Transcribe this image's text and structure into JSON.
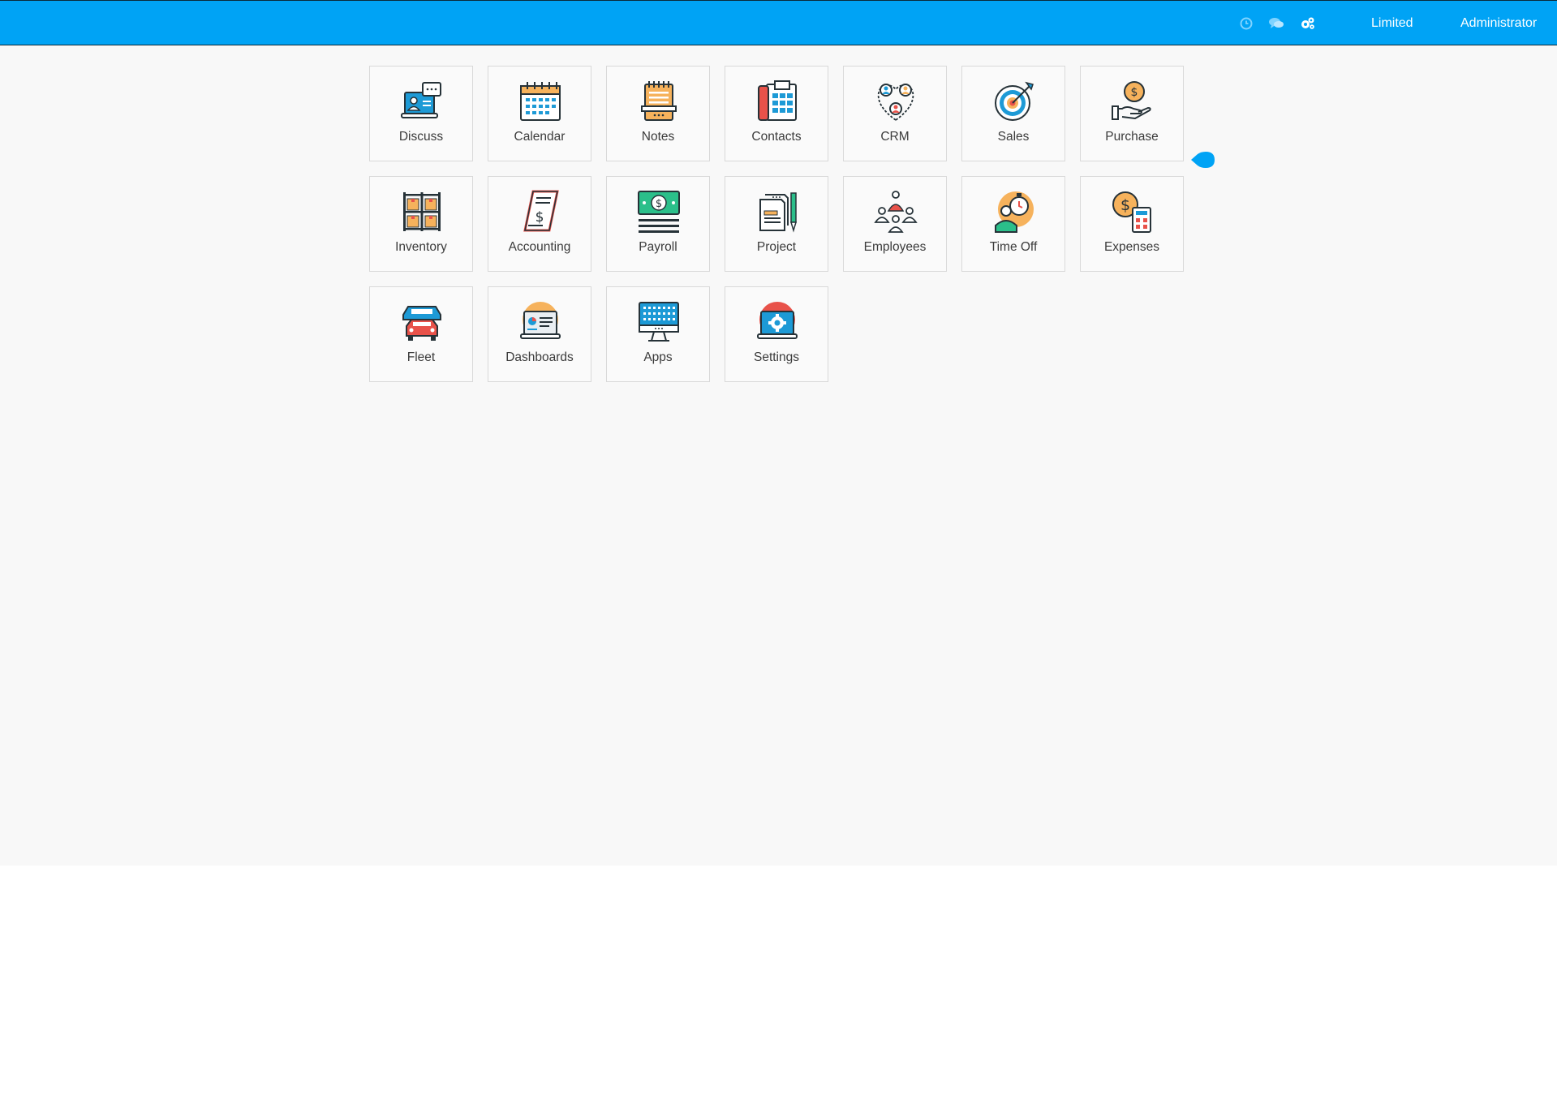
{
  "topbar": {
    "icons": [
      "clock-icon",
      "chat-icon",
      "gears-icon"
    ],
    "company": "Limited",
    "user": "Administrator",
    "color": "#00a3f5"
  },
  "apps": [
    {
      "label": "Discuss",
      "icon": "discuss-icon"
    },
    {
      "label": "Calendar",
      "icon": "calendar-icon"
    },
    {
      "label": "Notes",
      "icon": "notes-icon"
    },
    {
      "label": "Contacts",
      "icon": "contacts-icon"
    },
    {
      "label": "CRM",
      "icon": "crm-icon"
    },
    {
      "label": "Sales",
      "icon": "sales-icon"
    },
    {
      "label": "Purchase",
      "icon": "purchase-icon"
    },
    {
      "label": "Inventory",
      "icon": "inventory-icon"
    },
    {
      "label": "Accounting",
      "icon": "accounting-icon"
    },
    {
      "label": "Payroll",
      "icon": "payroll-icon"
    },
    {
      "label": "Project",
      "icon": "project-icon"
    },
    {
      "label": "Employees",
      "icon": "employees-icon"
    },
    {
      "label": "Time Off",
      "icon": "time-off-icon"
    },
    {
      "label": "Expenses",
      "icon": "expenses-icon"
    },
    {
      "label": "Fleet",
      "icon": "fleet-icon"
    },
    {
      "label": "Dashboards",
      "icon": "dashboards-icon"
    },
    {
      "label": "Apps",
      "icon": "apps-icon"
    },
    {
      "label": "Settings",
      "icon": "settings-icon"
    }
  ]
}
